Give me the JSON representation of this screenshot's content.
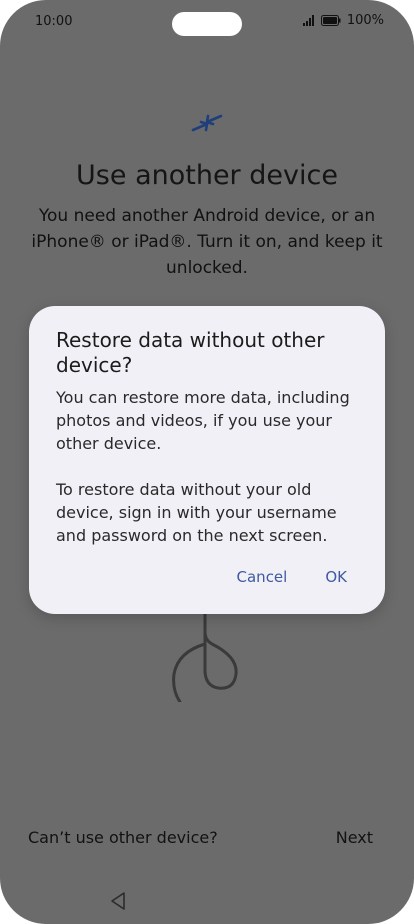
{
  "status_bar": {
    "time": "10:00",
    "battery": "100%"
  },
  "background": {
    "icon": "swap-arrows-icon",
    "title": "Use another device",
    "description": "You need another Android device, or an iPhone® or iPad®. Turn it on, and keep it unlocked.",
    "cable_icon": "usb-cable-icon",
    "secondary_action": "Can’t use other device?",
    "primary_action": "Next"
  },
  "dialog": {
    "title": "Restore data without other device?",
    "paragraph_1": "You can restore more data, including photos and videos, if you use your other device.",
    "paragraph_2": "To restore data without your old device, sign in with your username and password on the next screen.",
    "cancel_label": "Cancel",
    "ok_label": "OK"
  },
  "navigation": {
    "back_icon": "back-triangle-icon"
  },
  "colors": {
    "scrim": "#6b6b6b",
    "dialog_bg": "#f1f0f6",
    "accent": "#3e5aa0",
    "icon_blue": "#1f3f7a"
  }
}
